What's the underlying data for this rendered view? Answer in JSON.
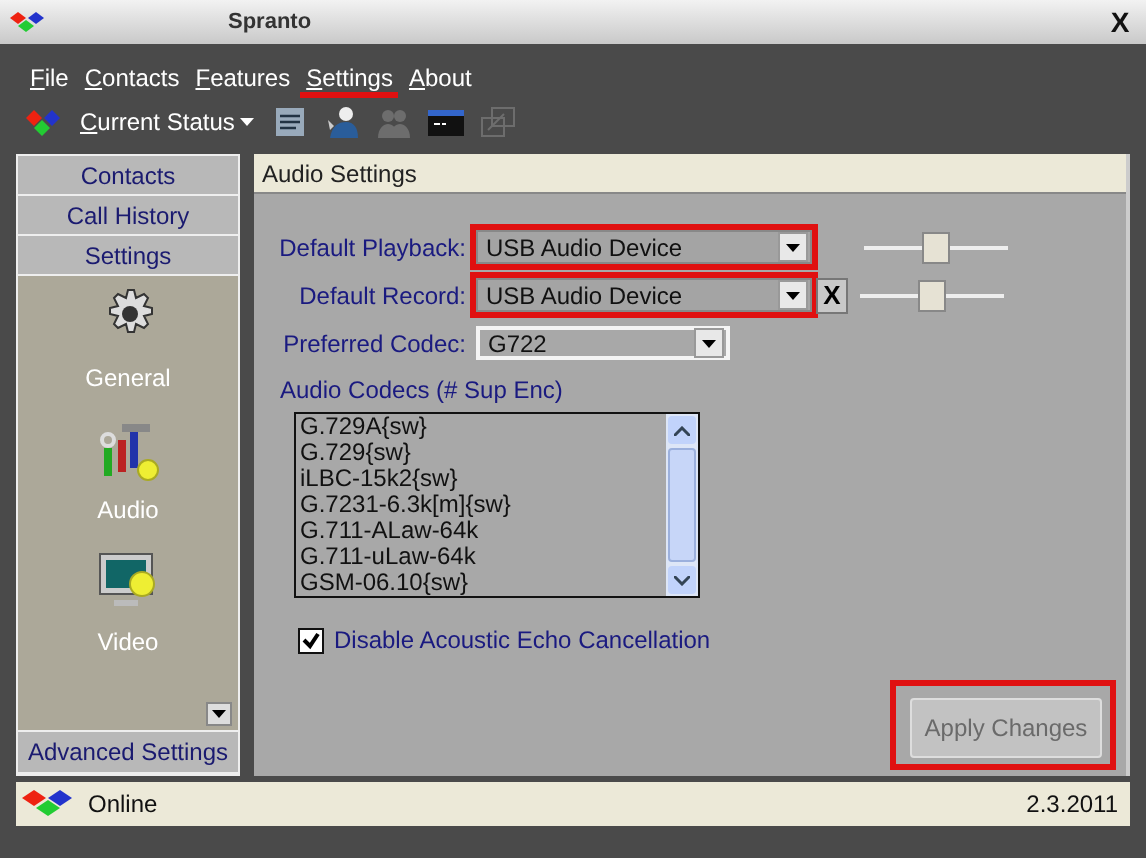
{
  "window": {
    "title": "Spranto",
    "close": "X"
  },
  "menu": [
    {
      "label": "File",
      "highlighted": false
    },
    {
      "label": "Contacts",
      "highlighted": false
    },
    {
      "label": "Features",
      "highlighted": false
    },
    {
      "label": "Settings",
      "highlighted": true
    },
    {
      "label": "About",
      "highlighted": false
    }
  ],
  "toolbar": {
    "status_label": "Current Status",
    "icons": [
      {
        "kind": "notes",
        "disabled": false
      },
      {
        "kind": "phone-user",
        "disabled": false
      },
      {
        "kind": "users",
        "disabled": true
      },
      {
        "kind": "terminal",
        "disabled": false
      },
      {
        "kind": "transfer",
        "disabled": true
      }
    ]
  },
  "sidebar": {
    "tabs": [
      "Contacts",
      "Call History",
      "Settings"
    ],
    "items": [
      {
        "label": "General",
        "kind": "general"
      },
      {
        "label": "Audio",
        "kind": "audio"
      },
      {
        "label": "Video",
        "kind": "video"
      }
    ],
    "footer_tab": "Advanced Settings"
  },
  "content": {
    "title": "Audio Settings",
    "fields": [
      {
        "kind": "device",
        "label": "Default Playback:",
        "value": "USB Audio Device",
        "highlighted": true,
        "level": 0.5
      },
      {
        "kind": "device",
        "label": "Default Record:",
        "value": "USB Audio Device",
        "highlighted": true,
        "level": 0.5,
        "clear_button": "X"
      },
      {
        "kind": "codec",
        "label": "Preferred Codec:",
        "value": "G722"
      }
    ],
    "codecs": {
      "label": "Audio Codecs (# Sup Enc)",
      "items": [
        "G.729A{sw}",
        "G.729{sw}",
        "iLBC-15k2{sw}",
        "G.7231-6.3k[m]{sw}",
        "G.711-ALaw-64k",
        "G.711-uLaw-64k",
        "GSM-06.10{sw}"
      ]
    },
    "echo_cancel": {
      "label": "Disable Acoustic Echo Cancellation",
      "checked": true
    },
    "apply_button": {
      "label": "Apply Changes",
      "disabled": true,
      "highlighted": true
    }
  },
  "status_bar": {
    "status": "Online",
    "date": "2.3.2011"
  }
}
